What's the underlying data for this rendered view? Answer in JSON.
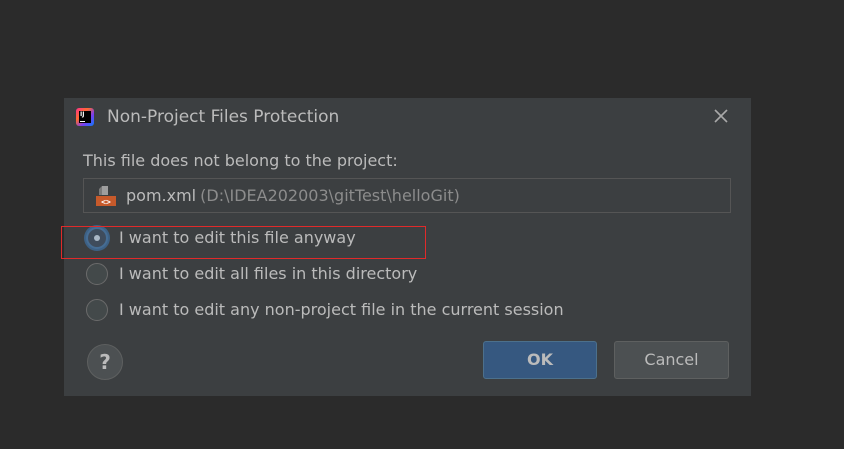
{
  "dialog": {
    "title": "Non-Project Files Protection",
    "app_icon": "intellij-idea-icon",
    "message": "This file does not belong to the project:",
    "file": {
      "icon": "maven-xml-file-icon",
      "name": "pom.xml",
      "path": "(D:\\IDEA202003\\gitTest\\helloGit)"
    },
    "options": [
      {
        "label": "I want to edit this file anyway",
        "checked": true
      },
      {
        "label": "I want to edit all files in this directory",
        "checked": false
      },
      {
        "label": "I want to edit any non-project file in the current session",
        "checked": false
      }
    ],
    "buttons": {
      "help_label": "?",
      "ok_label": "OK",
      "cancel_label": "Cancel"
    }
  },
  "colors": {
    "background": "#2b2b2b",
    "dialog": "#3c3f41",
    "text": "#bbbbbb",
    "path_text": "#8c8c8c",
    "default_button": "#365880",
    "annotation": "#e02a2a"
  }
}
